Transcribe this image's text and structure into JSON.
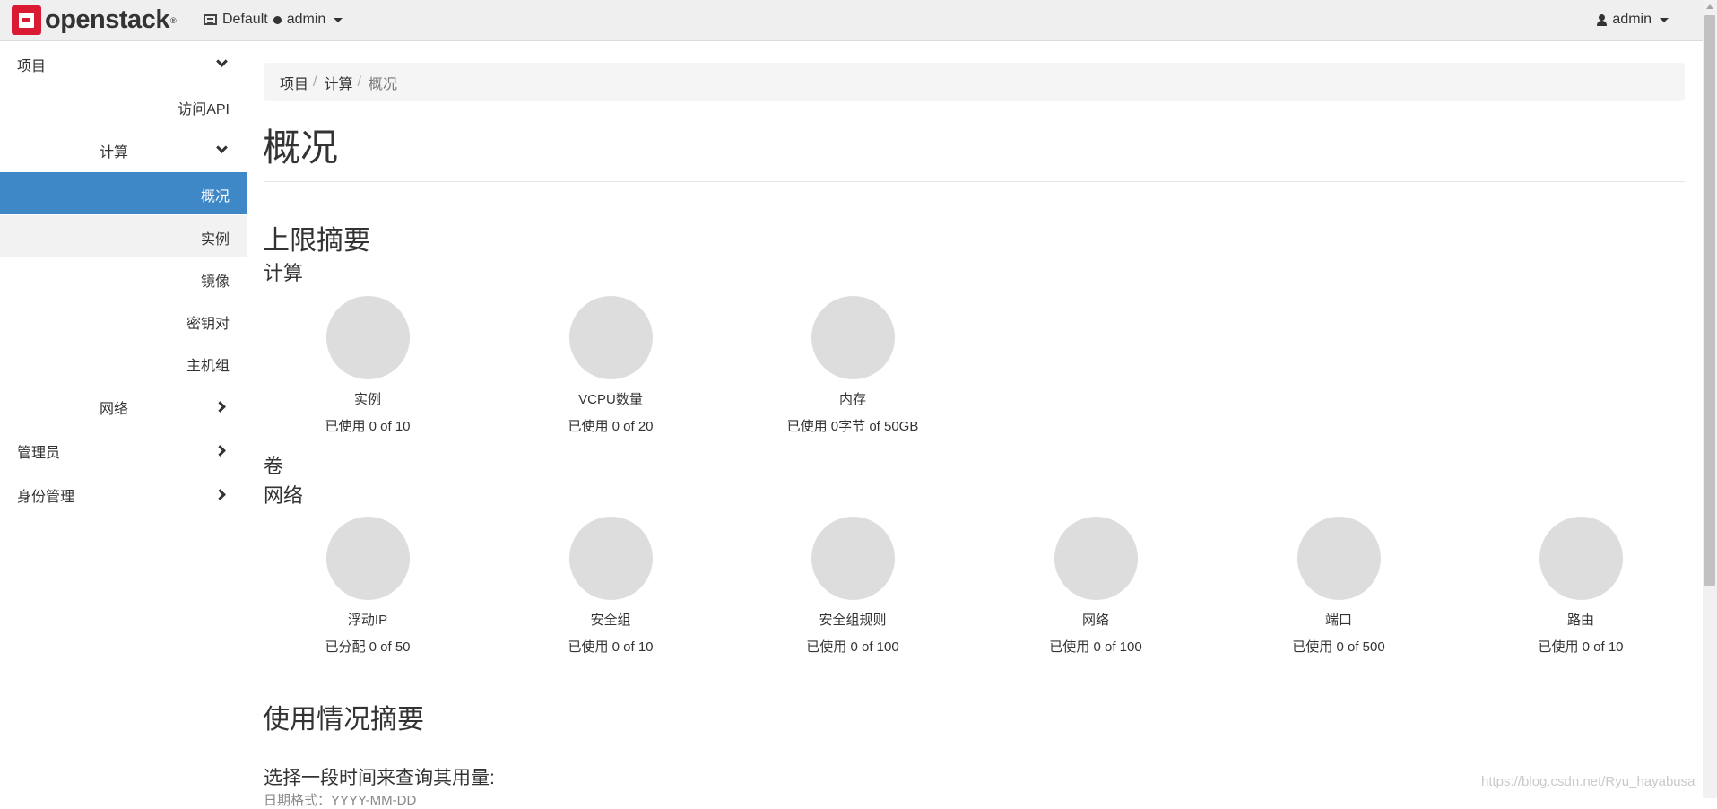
{
  "navbar": {
    "brand": "openstack",
    "brand_mark": "®",
    "domain": "Default",
    "project": "admin",
    "user": "admin"
  },
  "sidebar": {
    "project": "项目",
    "api_access": "访问API",
    "compute": "计算",
    "overview": "概况",
    "instances": "实例",
    "images": "镜像",
    "key_pairs": "密钥对",
    "server_groups": "主机组",
    "network": "网络",
    "admin": "管理员",
    "identity": "身份管理"
  },
  "breadcrumb": {
    "project": "项目",
    "compute": "计算",
    "current": "概况",
    "sep": "/"
  },
  "page": {
    "title": "概况",
    "limit_summary": "上限摘要",
    "compute_heading": "计算",
    "volume_heading": "卷",
    "network_heading": "网络",
    "usage_summary": "使用情况摘要",
    "query_label": "选择一段时间来查询其用量:",
    "date_hint": "日期格式：YYYY-MM-DD"
  },
  "compute_charts": [
    {
      "label": "实例",
      "usage": "已使用 0 of 10",
      "used": 0,
      "limit": 10
    },
    {
      "label": "VCPU数量",
      "usage": "已使用 0 of 20",
      "used": 0,
      "limit": 20
    },
    {
      "label": "内存",
      "usage": "已使用 0字节 of 50GB",
      "used": 0,
      "limit": 50
    }
  ],
  "network_charts": [
    {
      "label": "浮动IP",
      "usage": "已分配 0 of 50",
      "used": 0,
      "limit": 50
    },
    {
      "label": "安全组",
      "usage": "已使用 0 of 10",
      "used": 0,
      "limit": 10
    },
    {
      "label": "安全组规则",
      "usage": "已使用 0 of 100",
      "used": 0,
      "limit": 100
    },
    {
      "label": "网络",
      "usage": "已使用 0 of 100",
      "used": 0,
      "limit": 100
    },
    {
      "label": "端口",
      "usage": "已使用 0 of 500",
      "used": 0,
      "limit": 500
    },
    {
      "label": "路由",
      "usage": "已使用 0 of 10",
      "used": 0,
      "limit": 10
    }
  ],
  "watermark": "https://blog.csdn.net/Ryu_hayabusa",
  "colors": {
    "accent": "#3f88c8",
    "brand_red": "#da1a32",
    "pie_empty": "#dddddd"
  }
}
